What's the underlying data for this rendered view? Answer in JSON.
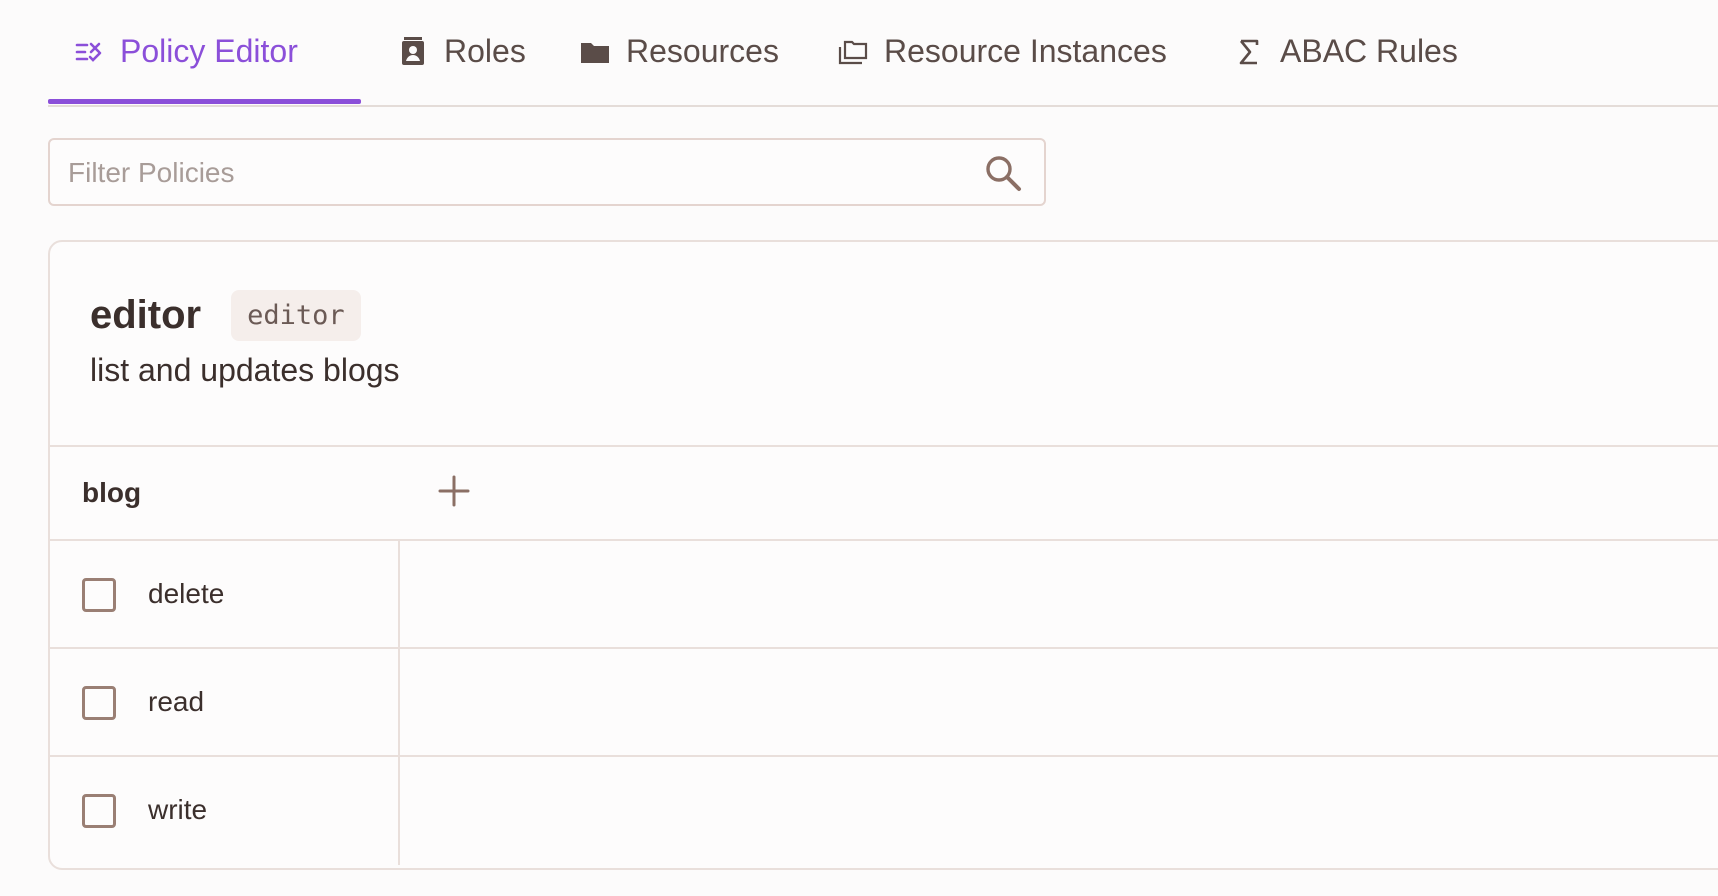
{
  "tabs": [
    {
      "label": "Policy Editor",
      "icon": "policy-editor-icon",
      "active": true
    },
    {
      "label": "Roles",
      "icon": "roles-icon",
      "active": false
    },
    {
      "label": "Resources",
      "icon": "folder-icon",
      "active": false
    },
    {
      "label": "Resource Instances",
      "icon": "resource-instances-icon",
      "active": false
    },
    {
      "label": "ABAC Rules",
      "icon": "sigma-icon",
      "active": false
    }
  ],
  "search": {
    "placeholder": "Filter Policies",
    "value": ""
  },
  "role": {
    "name": "editor",
    "key": "editor",
    "description": "list and updates blogs"
  },
  "resource": {
    "name": "blog",
    "actions": [
      {
        "label": "delete",
        "checked": false
      },
      {
        "label": "read",
        "checked": false
      },
      {
        "label": "write",
        "checked": false
      }
    ]
  },
  "colors": {
    "accent": "#8b4fd9",
    "text": "#3b2f2c",
    "border": "#e9dfdb",
    "checkbox": "#9a7f74"
  }
}
